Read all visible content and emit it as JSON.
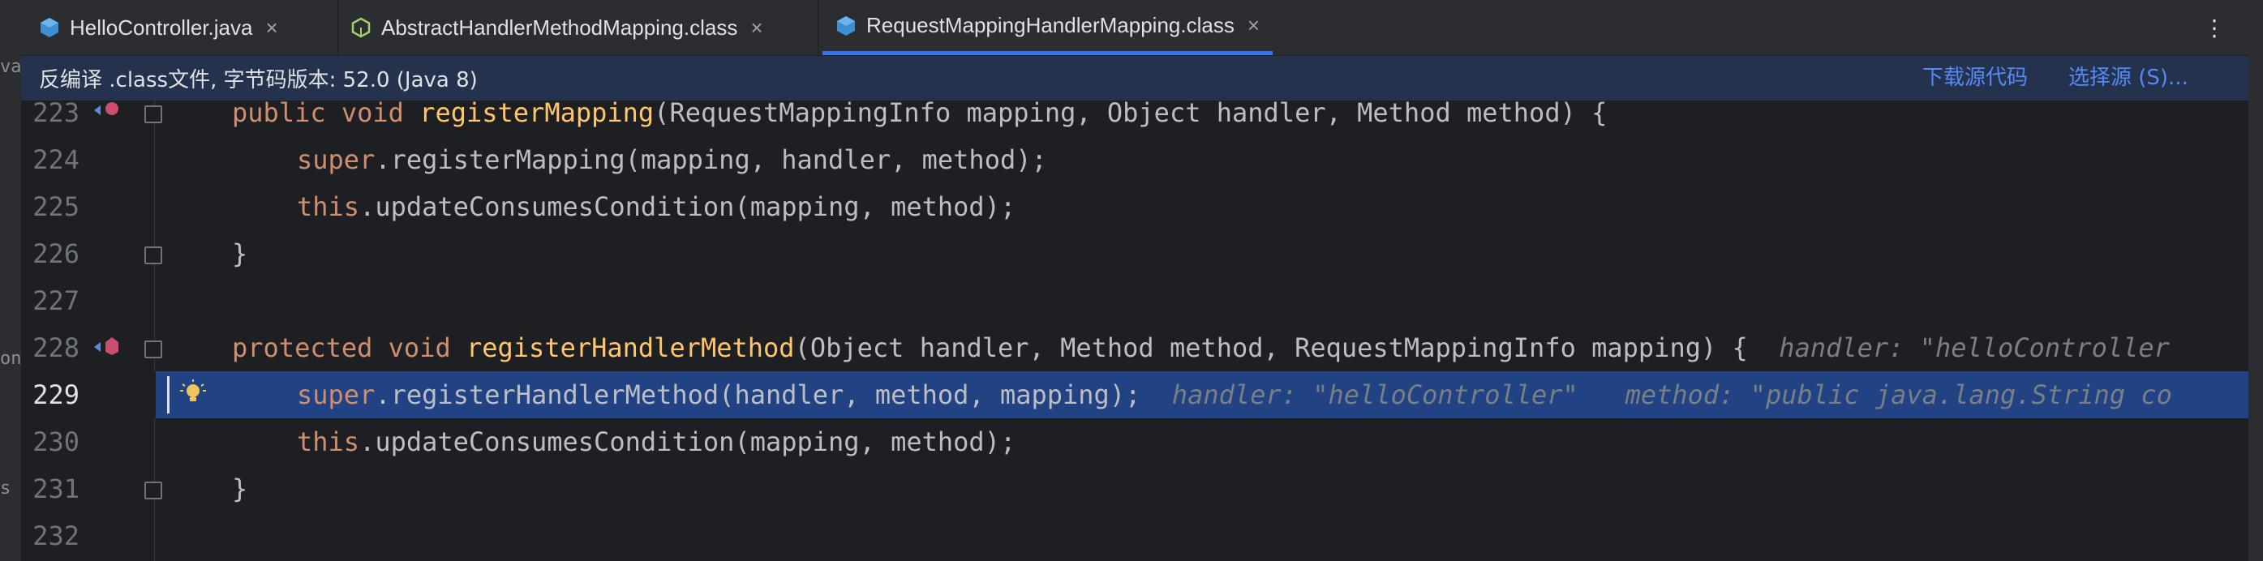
{
  "left_strip": {
    "fragments": [
      "va",
      "on",
      "s"
    ]
  },
  "tabs": [
    {
      "label": "HelloController.java",
      "icon": "java-class-icon",
      "active": false
    },
    {
      "label": "AbstractHandlerMethodMapping.class",
      "icon": "abstract-class-icon",
      "active": false
    },
    {
      "label": "RequestMappingHandlerMapping.class",
      "icon": "class-file-icon",
      "active": true
    }
  ],
  "tab_close": "×",
  "tab_more": "⋮",
  "banner": {
    "message": "反编译 .class文件, 字节码版本: 52.0 (Java 8)",
    "download_link": "下载源代码",
    "choose_link": "选择源 (S)..."
  },
  "code_lines": [
    {
      "number": "223",
      "html_key": "l223"
    },
    {
      "number": "224",
      "html_key": "l224"
    },
    {
      "number": "225",
      "html_key": "l225"
    },
    {
      "number": "226",
      "html_key": "l226"
    },
    {
      "number": "227",
      "html_key": "l227"
    },
    {
      "number": "228",
      "html_key": "l228"
    },
    {
      "number": "229",
      "html_key": "l229"
    },
    {
      "number": "230",
      "html_key": "l230"
    },
    {
      "number": "231",
      "html_key": "l231"
    },
    {
      "number": "232",
      "html_key": "l232"
    }
  ],
  "code": {
    "l223_kw": "public void ",
    "l223_fn": "registerMapping",
    "l223_rest": "(RequestMappingInfo mapping, Object handler, Method method) {",
    "l224_kw": "super",
    "l224_rest": ".registerMapping(mapping, handler, method);",
    "l225_kw": "this",
    "l225_rest": ".updateConsumesCondition(mapping, method);",
    "l226": "}",
    "l228_kw": "protected void ",
    "l228_fn": "registerHandlerMethod",
    "l228_rest": "(Object handler, Method method, RequestMappingInfo mapping) {",
    "l228_hint": "handler: \"helloController",
    "l229_kw": "super",
    "l229_rest": ".registerHandlerMethod(handler, method, mapping);",
    "l229_hint1": "handler: \"helloController\"",
    "l229_hint2": "method: \"public java.lang.String co",
    "l230_kw": "this",
    "l230_rest": ".updateConsumesCondition(mapping, method);",
    "l231": "}"
  },
  "colors": {
    "background": "#1e1f22",
    "keyword": "#cf8e6d",
    "method_decl": "#56a8f5",
    "highlight_line": "#214283",
    "banner": "#25324d",
    "link": "#548af7"
  }
}
